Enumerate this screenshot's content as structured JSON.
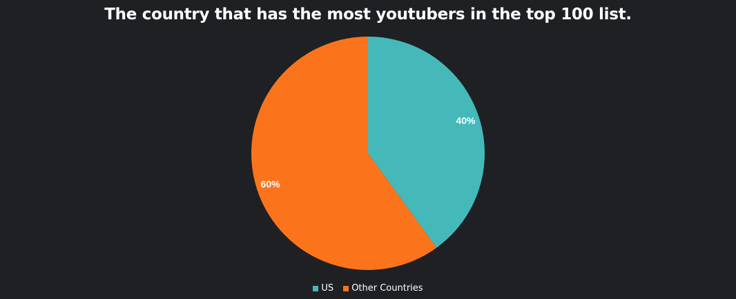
{
  "chart_data": {
    "type": "pie",
    "title": "The country that has the most youtubers in the top 100 list.",
    "slices": [
      {
        "name": "US",
        "value": 40,
        "label": "40%",
        "color": "#45b9b9"
      },
      {
        "name": "Other Countries",
        "value": 60,
        "label": "60%",
        "color": "#fb741b"
      }
    ],
    "start_angle": "12 o'clock",
    "direction": "clockwise",
    "legend_position": "bottom",
    "background": "#1f2024"
  }
}
